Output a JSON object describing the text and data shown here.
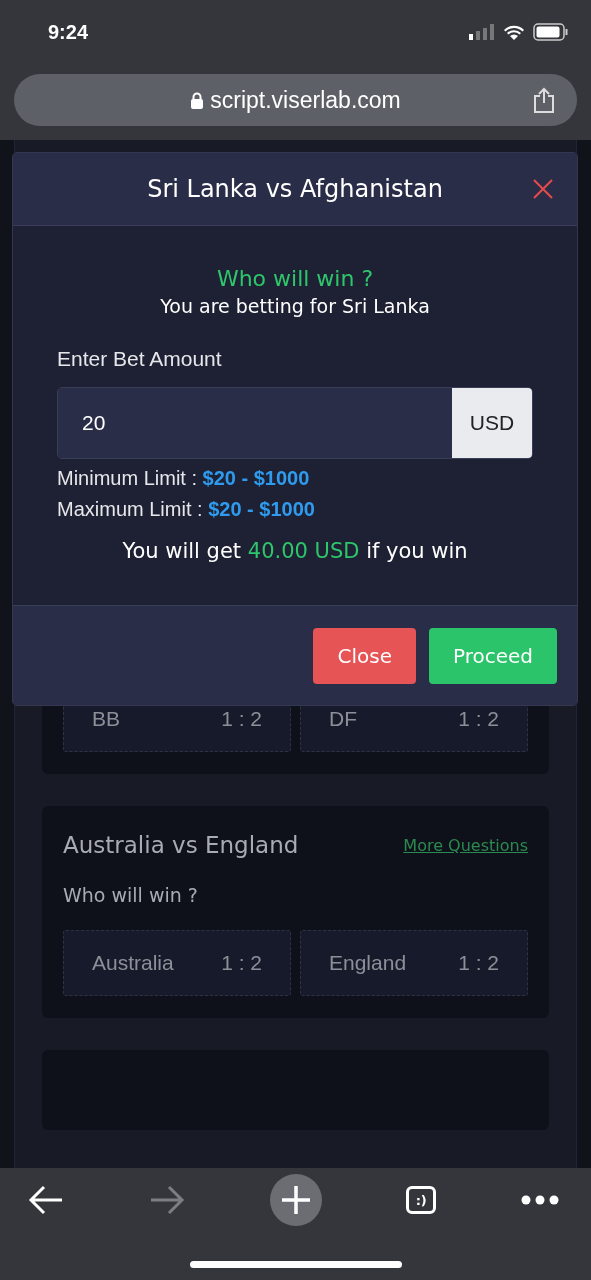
{
  "status_bar": {
    "time": "9:24"
  },
  "browser": {
    "url": "script.viserlab.com"
  },
  "modal": {
    "title": "Sri Lanka vs Afghanistan",
    "question": "Who will win ?",
    "subtitle": "You are betting for Sri Lanka",
    "amount_label": "Enter Bet Amount",
    "amount": {
      "value": "20",
      "unit": "USD"
    },
    "limits": [
      {
        "label": "Minimum Limit :",
        "value": "$20 - $1000"
      },
      {
        "label": "Maximum Limit :",
        "value": "$20 - $1000"
      }
    ],
    "payout": {
      "prefix": "You will get",
      "amount": "40.00 USD",
      "suffix": "if you win"
    },
    "buttons": [
      {
        "label": "Close",
        "kind": "cancel"
      },
      {
        "label": "Proceed",
        "kind": "confirm"
      }
    ]
  },
  "matches": [
    {
      "options": [
        {
          "name": "BB",
          "odds": "1 : 2"
        },
        {
          "name": "DF",
          "odds": "1 : 2"
        }
      ]
    },
    {
      "title": "Australia vs England",
      "link": "More Questions",
      "question": "Who will win ?",
      "options": [
        {
          "name": "Australia",
          "odds": "1 : 2"
        },
        {
          "name": "England",
          "odds": "1 : 2"
        }
      ]
    }
  ],
  "toolbar": {
    "back": {
      "disabled": false
    },
    "forward": {
      "disabled": true
    },
    "tabs": ":)"
  }
}
